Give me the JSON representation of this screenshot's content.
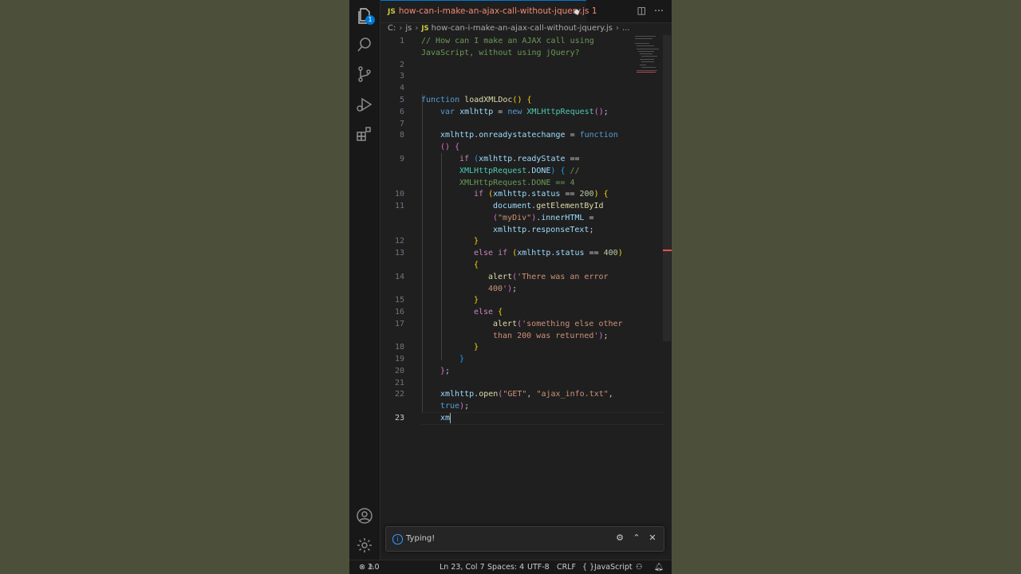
{
  "tab": {
    "lang": "JS",
    "filename": "how-can-i-make-an-ajax-call-without-jquery.js",
    "problems": "1"
  },
  "activity": {
    "explorer_badge": "1"
  },
  "breadcrumb": {
    "drive": "C:",
    "folder": "js",
    "lang": "JS",
    "file": "how-can-i-make-an-ajax-call-without-jquery.js",
    "more": "..."
  },
  "code": {
    "l1a": "// How can I make an AJAX call using",
    "l1b": "JavaScript, without using jQuery?",
    "l5_kw": "function",
    "l5_fn": "loadXMLDoc",
    "l5_paren": "()",
    "l5_brace": "{",
    "l6_kw": "var",
    "l6_var": "xmlhttp",
    "l6_eq": " = ",
    "l6_new": "new",
    "l6_cls": "XMLHttpRequest",
    "l6_paren": "()",
    "l6_semi": ";",
    "l8_var": "xmlhttp",
    "l8_dot": ".",
    "l8_prop": "onreadystatechange",
    "l8_eq": " = ",
    "l8_kw": "function",
    "l8b_paren": "()",
    "l8b_brace": "{",
    "l9_if": "if",
    "l9_paren": "(",
    "l9_var": "xmlhttp",
    "l9_dot": ".",
    "l9_prop": "readyState",
    "l9_op": " ==",
    "l9b_cls": "XMLHttpRequest",
    "l9b_dot": ".",
    "l9b_prop": "DONE",
    "l9b_close": ")",
    "l9b_brace": "{",
    "l9b_cmt": "//",
    "l9c_cmt": "XMLHttpRequest.DONE == 4",
    "l10_if": "if",
    "l10_open": "(",
    "l10_var": "xmlhttp",
    "l10_dot": ".",
    "l10_prop": "status",
    "l10_op": " == ",
    "l10_num": "200",
    "l10_close": ")",
    "l10_brace": "{",
    "l11_var": "document",
    "l11_dot": ".",
    "l11_fn": "getElementById",
    "l11b_open": "(",
    "l11b_str": "\"myDiv\"",
    "l11b_close": ")",
    "l11b_dot": ".",
    "l11b_prop": "innerHTML",
    "l11b_eq": " =",
    "l11c_var": "xmlhttp",
    "l11c_dot": ".",
    "l11c_prop": "responseText",
    "l11c_semi": ";",
    "l12": "}",
    "l13_else": "else",
    "l13_if": "if",
    "l13_open": "(",
    "l13_var": "xmlhttp",
    "l13_dot": ".",
    "l13_prop": "status",
    "l13_op": " == ",
    "l13_num": "400",
    "l13_close": ")",
    "l13b": "{",
    "l14_fn": "alert",
    "l14_open": "(",
    "l14_str": "'There was an error",
    "l14b_str": "400'",
    "l14b_close": ")",
    "l14b_semi": ";",
    "l15": "}",
    "l16_else": "else",
    "l16_brace": "{",
    "l17_fn": "alert",
    "l17_open": "(",
    "l17_str": "'something else other",
    "l17b_str": "than 200 was returned'",
    "l17b_close": ")",
    "l17b_semi": ";",
    "l18": "}",
    "l19": "}",
    "l20_brace": "}",
    "l20_semi": ";",
    "l22_var": "xmlhttp",
    "l22_dot": ".",
    "l22_fn": "open",
    "l22_open": "(",
    "l22_s1": "\"GET\"",
    "l22_c": ", ",
    "l22_s2": "\"ajax_info.txt\"",
    "l22_c2": ",",
    "l22b_kw": "true",
    "l22b_close": ")",
    "l22b_semi": ";",
    "l23": "xm"
  },
  "line_numbers": [
    "1",
    "2",
    "3",
    "4",
    "5",
    "6",
    "7",
    "8",
    "9",
    "10",
    "11",
    "12",
    "13",
    "14",
    "15",
    "16",
    "17",
    "18",
    "19",
    "20",
    "21",
    "22",
    "23"
  ],
  "notification": {
    "message": "Typing!"
  },
  "status": {
    "errors": "1",
    "warnings": "0",
    "position": "Ln 23, Col 7",
    "spaces": "Spaces: 4",
    "encoding": "UTF-8",
    "eol": "CRLF",
    "language": "JavaScript",
    "braces": "{ }"
  },
  "colors": {
    "accent": "#0078d4",
    "error": "#f14c4c",
    "editor_bg": "#1f1f1f",
    "backdrop": "#4c503b"
  }
}
